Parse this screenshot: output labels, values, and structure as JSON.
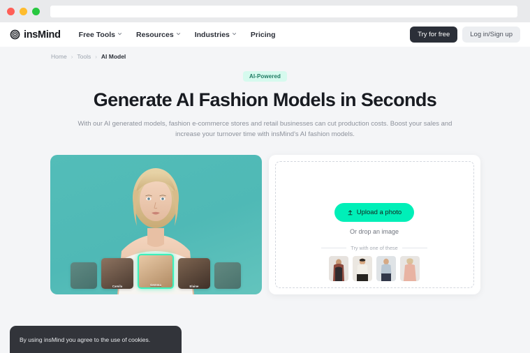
{
  "browser": {
    "url_value": "",
    "url_placeholder": "",
    "traffic_lights": [
      "close",
      "minimize",
      "maximize"
    ]
  },
  "header": {
    "logo_text": "insMind",
    "logo_icon": "spiral-circle-icon",
    "nav": [
      {
        "label": "Free Tools",
        "has_dropdown": true,
        "icon": "chevron-down-icon"
      },
      {
        "label": "Resources",
        "has_dropdown": true,
        "icon": "chevron-down-icon"
      },
      {
        "label": "Industries",
        "has_dropdown": true,
        "icon": "chevron-down-icon"
      },
      {
        "label": "Pricing",
        "has_dropdown": false
      }
    ],
    "try_label": "Try for free",
    "login_label": "Log in/Sign up"
  },
  "breadcrumb": {
    "home": "Home",
    "tools": "Tools",
    "current": "AI Model",
    "separator": "›"
  },
  "hero": {
    "badge": "AI-Powered",
    "title": "Generate AI Fashion Models in Seconds",
    "subtitle": "With our AI generated models, fashion e-commerce stores and retail businesses can cut production costs. Boost your sales and increase your turnover time with insMind's AI fashion models."
  },
  "preview": {
    "alt": "ai-fashion-model-preview",
    "faces": [
      {
        "name": "",
        "selected": false,
        "edge": true
      },
      {
        "name": "Camila",
        "selected": false,
        "edge": false
      },
      {
        "name": "Gemma",
        "selected": true,
        "edge": false
      },
      {
        "name": "Elaine",
        "selected": false,
        "edge": false
      },
      {
        "name": "",
        "selected": false,
        "edge": true
      }
    ]
  },
  "upload": {
    "button_label": "Upload a photo",
    "button_icon": "upload-arrow-icon",
    "drop_hint": "Or drop an image",
    "try_label": "Try with one of these",
    "samples": [
      {
        "alt": "sample-model-1"
      },
      {
        "alt": "sample-model-2"
      },
      {
        "alt": "sample-model-3"
      },
      {
        "alt": "sample-model-4"
      }
    ]
  },
  "cookie": {
    "text": "By using insMind you agree to the use of cookies."
  },
  "colors": {
    "accent_green": "#00efb8",
    "badge_bg": "#d6faee",
    "dark": "#2b2f38",
    "page_bg": "#f4f5f7",
    "preview_teal": "#53bdb8"
  }
}
